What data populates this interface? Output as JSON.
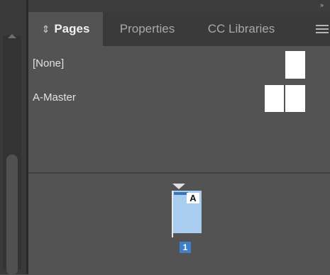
{
  "panel": {
    "collapse_icon": "»",
    "tabs": [
      {
        "label": "Pages",
        "active": true,
        "icon": "sort-arrows-icon"
      },
      {
        "label": "Properties",
        "active": false
      },
      {
        "label": "CC Libraries",
        "active": false
      }
    ],
    "menu_icon": "hamburger-menu-icon"
  },
  "masters": [
    {
      "label": "[None]",
      "thumbnail": "single-page"
    },
    {
      "label": "A-Master",
      "thumbnail": "spread"
    }
  ],
  "pages": [
    {
      "number": "1",
      "master_prefix": "A",
      "selected": true
    }
  ],
  "colors": {
    "panel_bg": "#535353",
    "tab_bar_bg": "#3a3a3a",
    "selected_page": "#a8cdee",
    "page_number_badge": "#3f7fc9"
  }
}
